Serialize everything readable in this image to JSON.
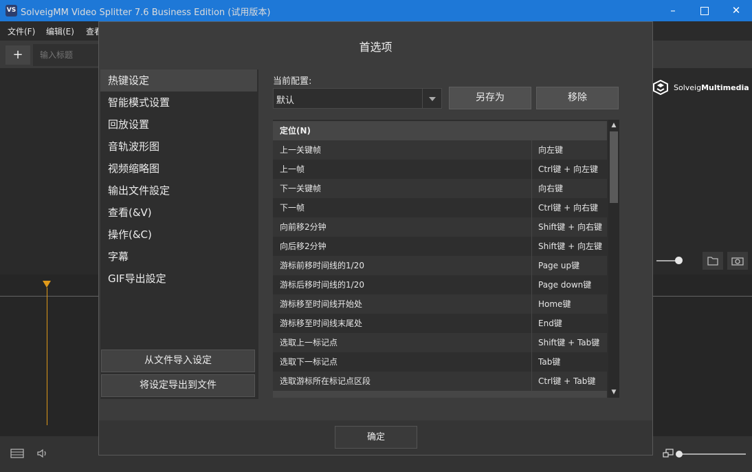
{
  "window": {
    "app_icon": "VS",
    "title": "SolveigMM Video Splitter 7.6 Business Edition  (试用版本)",
    "controls": [
      "minimize-icon",
      "maximize-icon",
      "close-icon"
    ]
  },
  "menu": [
    "文件(F)",
    "编辑(E)",
    "查看"
  ],
  "toolbar": {
    "add_label": "+",
    "title_placeholder": "输入标题"
  },
  "brand": {
    "logo_text_light": "Solveig",
    "logo_text_bold": "Multimedia"
  },
  "dialog": {
    "title": "首选项",
    "categories": [
      "热键设定",
      "智能模式设置",
      "回放设置",
      "音轨波形图",
      "视频缩略图",
      "输出文件設定",
      "查看(&V)",
      "操作(&C)",
      "字幕",
      "GIF导出設定"
    ],
    "active_category_index": 0,
    "import_button": "从文件导入设定",
    "export_button": "将设定导出到文件",
    "profile_label": "当前配置:",
    "profile_value": "默认",
    "save_as_button": "另存为",
    "remove_button": "移除",
    "group_label": "定位(N)",
    "hotkeys": [
      {
        "action": "上一关键帧",
        "key": "向左键"
      },
      {
        "action": "上一帧",
        "key": "Ctrl键 + 向左键"
      },
      {
        "action": "下一关键帧",
        "key": "向右键"
      },
      {
        "action": "下一帧",
        "key": "Ctrl键 + 向右键"
      },
      {
        "action": "向前移2分钟",
        "key": "Shift键 + 向右键"
      },
      {
        "action": "向后移2分钟",
        "key": "Shift键 + 向左键"
      },
      {
        "action": "游标前移时间线的1/20",
        "key": "Page up键"
      },
      {
        "action": "游标后移时间线的1/20",
        "key": "Page down键"
      },
      {
        "action": "游标移至时间线开始处",
        "key": "Home键"
      },
      {
        "action": "游标移至时间线末尾处",
        "key": "End键"
      },
      {
        "action": "选取上一标记点",
        "key": "Shift键 + Tab键"
      },
      {
        "action": "选取下一标记点",
        "key": "Tab键"
      },
      {
        "action": "选取游标所在标记点区段",
        "key": "Ctrl键 + Tab键"
      }
    ],
    "ok_button": "确定"
  },
  "colors": {
    "titlebar": "#1e78d7",
    "accent": "#e09a1a"
  }
}
